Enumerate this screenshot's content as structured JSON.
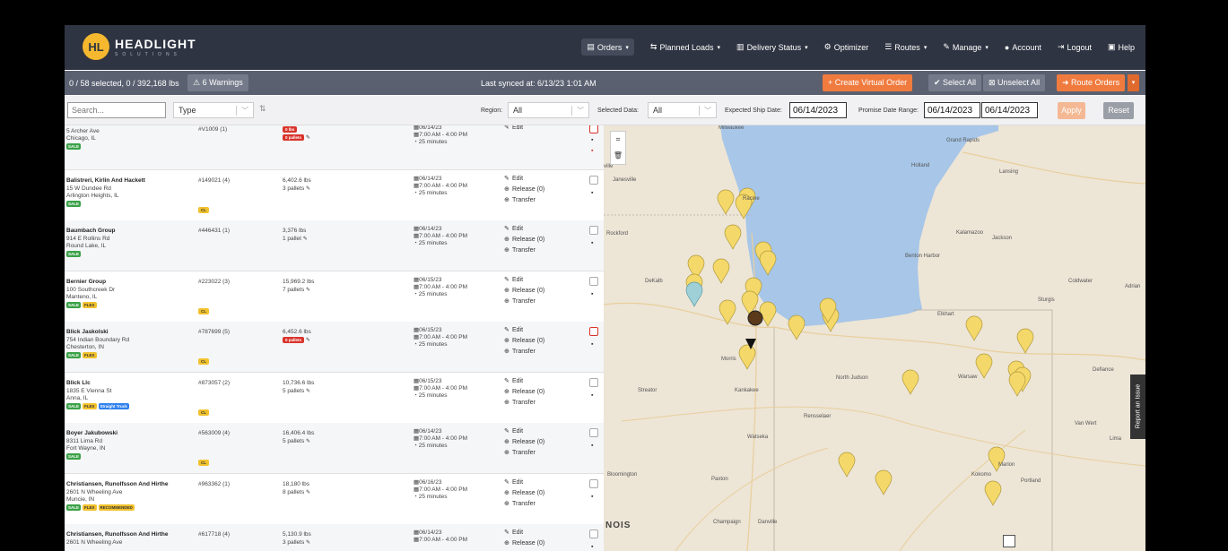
{
  "brand": {
    "name": "HEADLIGHT",
    "sub": "SOLUTIONS",
    "mark": "HL"
  },
  "nav": [
    {
      "icon": "▤",
      "label": "Orders",
      "caret": "▾",
      "active": true
    },
    {
      "icon": "⇆",
      "label": "Planned Loads",
      "caret": "▾"
    },
    {
      "icon": "▥",
      "label": "Delivery Status",
      "caret": "▾"
    },
    {
      "icon": "⚙",
      "label": "Optimizer",
      "caret": ""
    },
    {
      "icon": "☰",
      "label": "Routes",
      "caret": "▾"
    },
    {
      "icon": "✎",
      "label": "Manage",
      "caret": "▾"
    },
    {
      "icon": "●",
      "label": "Account",
      "caret": ""
    },
    {
      "icon": "⇥",
      "label": "Logout",
      "caret": ""
    },
    {
      "icon": "▣",
      "label": "Help",
      "caret": ""
    }
  ],
  "status": {
    "selection": "0 / 58 selected, 0 / 392,168 lbs",
    "warnings": "⚠ 6 Warnings",
    "synced": "Last synced at: 6/13/23 1:01 AM",
    "create_virtual": "+ Create Virtual Order",
    "select_all": "✔ Select All",
    "unselect_all": "⊠ Unselect All",
    "route_orders": "➜ Route Orders",
    "route_caret": "▾"
  },
  "filters": {
    "search_placeholder": "Search...",
    "type_placeholder": "Type",
    "region_label": "Region:",
    "region_value": "All",
    "selected_data_label": "Selected Data:",
    "selected_data_value": "All",
    "ship_date_label": "Expected Ship Date:",
    "ship_date_value": "06/14/2023",
    "promise_label": "Promise Date Range:",
    "promise_from": "06/14/2023",
    "promise_to": "06/14/2023",
    "apply": "Apply",
    "reset": "Reset"
  },
  "actions": {
    "edit": "Edit",
    "release": "Release (0)",
    "transfer": "Transfer"
  },
  "orders": [
    {
      "name": "",
      "street": "5 Archer Ave",
      "city": "Chicago, IL",
      "badges": [
        "SALE"
      ],
      "id": "#V1009 (1)",
      "cl": false,
      "weight": "0 lbs",
      "weight_red": true,
      "pallets": "0 pallets",
      "pallets_red": true,
      "date": "06/14/23",
      "time": "7:00 AM - 4:00 PM",
      "dur": "25 minutes",
      "actions": [
        "edit"
      ],
      "chk_red": true,
      "trash_red": true
    },
    {
      "name": "Balistreri, Kirlin And Hackett",
      "street": "15 W Dundee Rd",
      "city": "Arlington Heights, IL",
      "badges": [
        "SALE"
      ],
      "id": "#149021 (4)",
      "cl": true,
      "weight": "6,402.6 lbs",
      "pallets": "3 pallets",
      "date": "06/14/23",
      "time": "7:00 AM - 4:00 PM",
      "dur": "25 minutes",
      "actions": [
        "edit",
        "release",
        "transfer"
      ]
    },
    {
      "name": "Baumbach Group",
      "street": "914 E Rollins Rd",
      "city": "Round Lake, IL",
      "badges": [
        "SALE"
      ],
      "id": "#446431 (1)",
      "cl": false,
      "weight": "3,376 lbs",
      "pallets": "1 pallet",
      "date": "06/14/23",
      "time": "7:00 AM - 4:00 PM",
      "dur": "25 minutes",
      "actions": [
        "edit",
        "release",
        "transfer"
      ]
    },
    {
      "name": "Bernier Group",
      "street": "100 Southcreek Dr",
      "city": "Manteno, IL",
      "badges": [
        "SALE",
        "FLEX"
      ],
      "id": "#223022 (3)",
      "cl": true,
      "weight": "15,969.2 lbs",
      "pallets": "7 pallets",
      "date": "06/15/23",
      "time": "7:00 AM - 4:00 PM",
      "dur": "25 minutes",
      "actions": [
        "edit",
        "release",
        "transfer"
      ]
    },
    {
      "name": "Blick Jaskolski",
      "street": "754 Indian Boundary Rd",
      "city": "Chesterton, IN",
      "badges": [
        "SALE",
        "FLEX"
      ],
      "id": "#787699 (5)",
      "cl": true,
      "weight": "6,452.6 lbs",
      "pallets": "0 pallets",
      "pallets_red": true,
      "date": "06/15/23",
      "time": "7:00 AM - 4:00 PM",
      "dur": "25 minutes",
      "actions": [
        "edit",
        "release",
        "transfer"
      ],
      "chk_red": true
    },
    {
      "name": "Blick Llc",
      "street": "1835 E Vienna St",
      "city": "Anna, IL",
      "badges": [
        "SALE",
        "FLEX",
        "Straight Truck"
      ],
      "id": "#873057 (2)",
      "cl": true,
      "weight": "10,736.6 lbs",
      "pallets": "5 pallets",
      "date": "06/15/23",
      "time": "7:00 AM - 4:00 PM",
      "dur": "25 minutes",
      "actions": [
        "edit",
        "release",
        "transfer"
      ]
    },
    {
      "name": "Boyer Jakubowski",
      "street": "8311 Lima Rd",
      "city": "Fort Wayne, IN",
      "badges": [
        "SALE"
      ],
      "id": "#563009 (4)",
      "cl": true,
      "weight": "16,406.4 lbs",
      "pallets": "5 pallets",
      "date": "06/14/23",
      "time": "7:00 AM - 4:00 PM",
      "dur": "25 minutes",
      "actions": [
        "edit",
        "release",
        "transfer"
      ]
    },
    {
      "name": "Christiansen, Runolfsson And Hirthe",
      "street": "2601 N Wheeling Ave",
      "city": "Muncie, IN",
      "badges": [
        "SALE",
        "FLEX",
        "RECOMMENDED"
      ],
      "id": "#963362 (1)",
      "cl": false,
      "weight": "18,180 lbs",
      "pallets": "8 pallets",
      "date": "06/16/23",
      "time": "7:00 AM - 4:00 PM",
      "dur": "25 minutes",
      "actions": [
        "edit",
        "release",
        "transfer"
      ]
    },
    {
      "name": "Christiansen, Runolfsson And Hirthe",
      "street": "2601 N Wheeling Ave",
      "city": "",
      "badges": [],
      "id": "#617718 (4)",
      "cl": false,
      "weight": "5,130.9 lbs",
      "pallets": "3 pallets",
      "date": "06/14/23",
      "time": "7:00 AM - 4:00 PM",
      "dur": "",
      "actions": [
        "edit",
        "release"
      ]
    }
  ],
  "map": {
    "labels": [
      {
        "text": "Milwaukee"
      },
      {
        "text": "Grand Rapids"
      },
      {
        "text": "Holland"
      },
      {
        "text": "Lansing"
      },
      {
        "text": "Racine"
      },
      {
        "text": "Janesville"
      },
      {
        "text": "ville"
      },
      {
        "text": "Rockford"
      },
      {
        "text": "Kalamazoo"
      },
      {
        "text": "Jackson"
      },
      {
        "text": "Benton Harbor"
      },
      {
        "text": "DeKalb"
      },
      {
        "text": "Coldwater"
      },
      {
        "text": "Adrian"
      },
      {
        "text": "Sturgis"
      },
      {
        "text": "Elkhart"
      },
      {
        "text": "Morris"
      },
      {
        "text": "North Judson"
      },
      {
        "text": "Warsaw"
      },
      {
        "text": "Defiance"
      },
      {
        "text": "Streator"
      },
      {
        "text": "Kankakee"
      },
      {
        "text": "Rensselaer"
      },
      {
        "text": "Van Wert"
      },
      {
        "text": "Lima"
      },
      {
        "text": "Watseka"
      },
      {
        "text": "Marion"
      },
      {
        "text": "Bloomington"
      },
      {
        "text": "Paxton"
      },
      {
        "text": "Kokomo"
      },
      {
        "text": "Portland"
      },
      {
        "text": "Champaign"
      },
      {
        "text": "Danville"
      },
      {
        "text": "NOIS"
      }
    ],
    "report_issue": "Report an Issue"
  }
}
